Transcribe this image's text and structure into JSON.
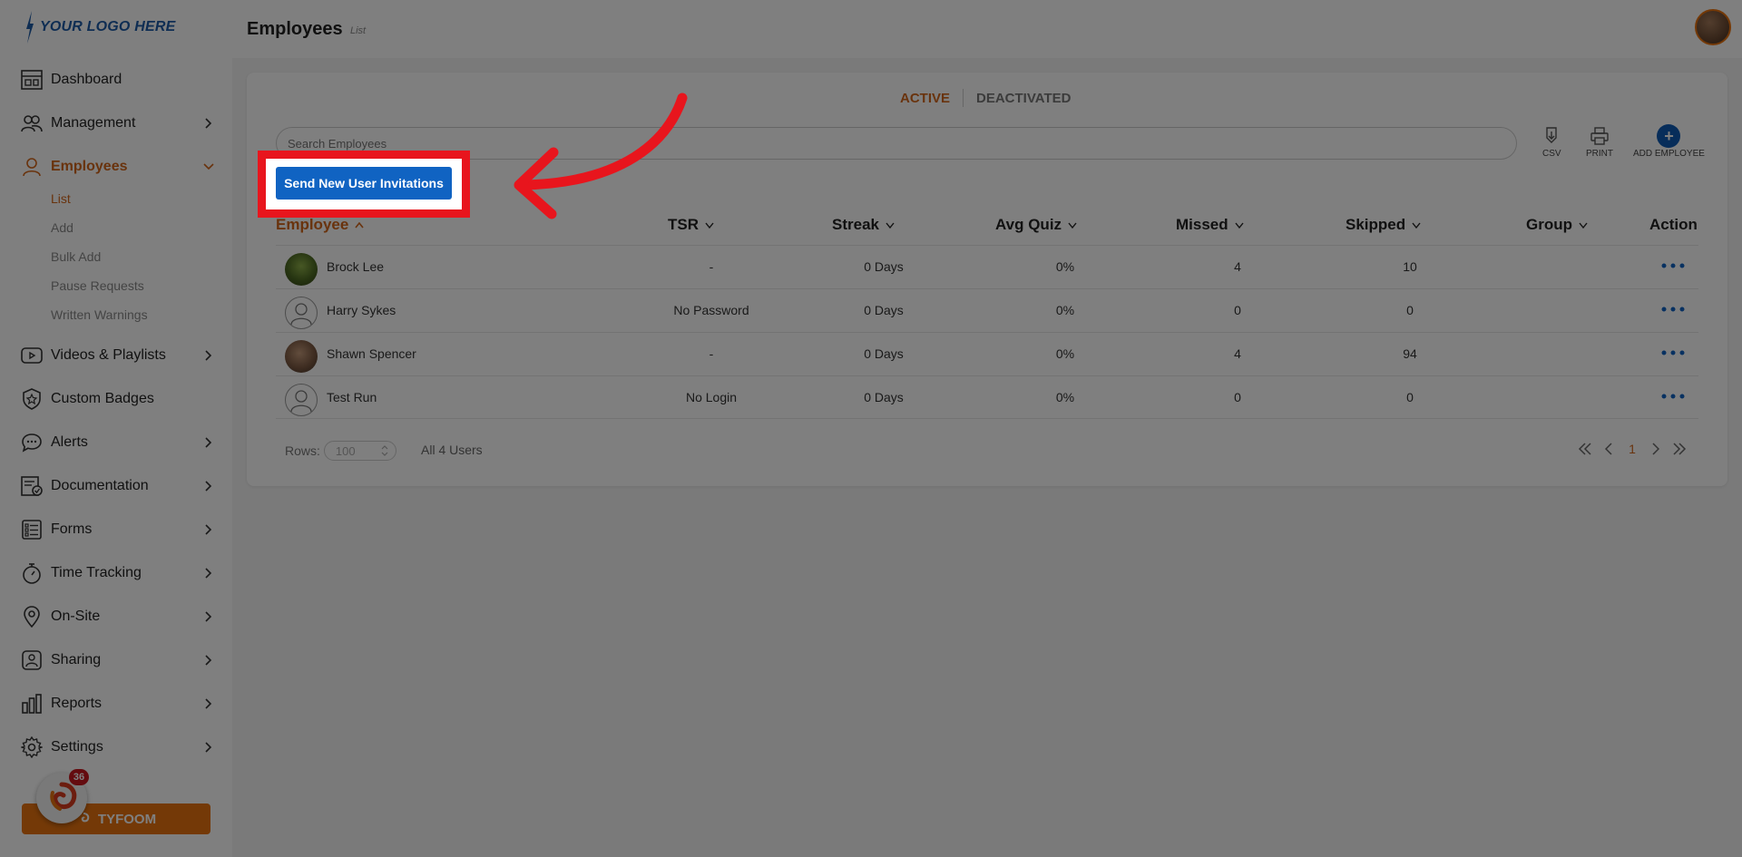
{
  "logo": {
    "text": "YOUR LOGO HERE"
  },
  "sidebar": {
    "items": [
      {
        "label": "Dashboard",
        "icon": "dashboard-icon"
      },
      {
        "label": "Management",
        "icon": "management-icon"
      },
      {
        "label": "Employees",
        "icon": "employees-icon"
      },
      {
        "label": "Videos & Playlists",
        "icon": "video-icon"
      },
      {
        "label": "Custom Badges",
        "icon": "badge-icon"
      },
      {
        "label": "Alerts",
        "icon": "alerts-icon"
      },
      {
        "label": "Documentation",
        "icon": "documentation-icon"
      },
      {
        "label": "Forms",
        "icon": "forms-icon"
      },
      {
        "label": "Time Tracking",
        "icon": "stopwatch-icon"
      },
      {
        "label": "On-Site",
        "icon": "location-pin-icon"
      },
      {
        "label": "Sharing",
        "icon": "sharing-icon"
      },
      {
        "label": "Reports",
        "icon": "reports-icon"
      },
      {
        "label": "Settings",
        "icon": "gear-icon"
      }
    ],
    "employees_sub": [
      "List",
      "Add",
      "Bulk Add",
      "Pause Requests",
      "Written Warnings"
    ],
    "tyfoom_label": "TYFOOM",
    "notification_count": "36"
  },
  "header": {
    "title": "Employees",
    "subtitle": "List"
  },
  "tabs": {
    "active": "ACTIVE",
    "inactive": "DEACTIVATED"
  },
  "search": {
    "placeholder": "Search Employees"
  },
  "tools": {
    "csv": "CSV",
    "print": "PRINT",
    "add_employee": "ADD EMPLOYEE"
  },
  "send_invitations_label": "Send New User Invitations",
  "table": {
    "columns": [
      "Employee",
      "TSR",
      "Streak",
      "Avg Quiz",
      "Missed",
      "Skipped",
      "Group",
      "Action"
    ],
    "rows": [
      {
        "name": "Brock Lee",
        "tsr": "-",
        "streak": "0 Days",
        "avg_quiz": "0%",
        "missed": "4",
        "skipped": "10",
        "group": ""
      },
      {
        "name": "Harry Sykes",
        "tsr": "No Password",
        "streak": "0 Days",
        "avg_quiz": "0%",
        "missed": "0",
        "skipped": "0",
        "group": ""
      },
      {
        "name": "Shawn Spencer",
        "tsr": "-",
        "streak": "0 Days",
        "avg_quiz": "0%",
        "missed": "4",
        "skipped": "94",
        "group": ""
      },
      {
        "name": "Test Run",
        "tsr": "No Login",
        "streak": "0 Days",
        "avg_quiz": "0%",
        "missed": "0",
        "skipped": "0",
        "group": ""
      }
    ]
  },
  "footer": {
    "rows_label": "Rows:",
    "rows_value": "100",
    "total": "All 4 Users",
    "current_page": "1"
  },
  "colors": {
    "accent": "#d3661b",
    "primary_blue": "#1063c2",
    "highlight_red": "#e8151d"
  }
}
